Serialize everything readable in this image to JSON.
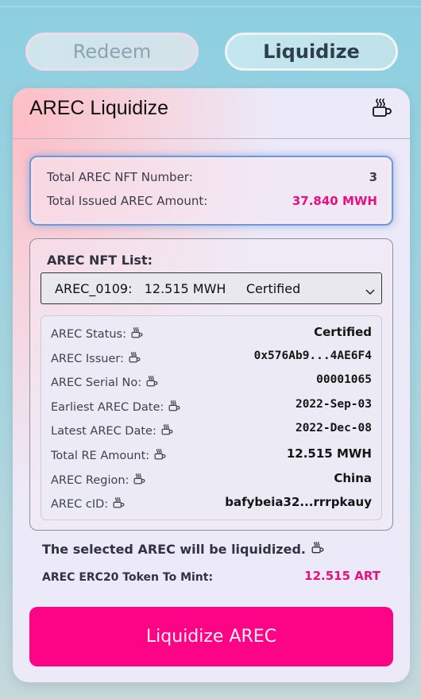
{
  "tabs": {
    "redeem_label": "Redeem",
    "liquidize_label": "Liquidize"
  },
  "card": {
    "title": "AREC Liquidize",
    "header_icon": "mug-icon"
  },
  "summary": {
    "nft_number_label": "Total AREC NFT Number:",
    "nft_number_value": "3",
    "issued_amount_label": "Total Issued AREC Amount:",
    "issued_amount_value": "37.840 MWH"
  },
  "nft_list": {
    "label": "AREC NFT List:",
    "selected_option": "AREC_0109:   12.515 MWH     Certified",
    "details": [
      {
        "label": "AREC Status:",
        "value": "Certified",
        "mono": false
      },
      {
        "label": "AREC Issuer:",
        "value": "0x576Ab9...4AE6F4",
        "mono": true
      },
      {
        "label": "AREC Serial No:",
        "value": "00001065",
        "mono": true
      },
      {
        "label": "Earliest AREC Date:",
        "value": "2022-Sep-03",
        "mono": true
      },
      {
        "label": "Latest AREC Date:",
        "value": "2022-Dec-08",
        "mono": true
      },
      {
        "label": "Total RE Amount:",
        "value": "12.515 MWH",
        "mono": false
      },
      {
        "label": "AREC Region:",
        "value": "China",
        "mono": false
      },
      {
        "label": "AREC cID:",
        "value": "bafybeia32...rrrpkauy",
        "mono": false
      }
    ]
  },
  "notice": "The selected AREC will be liquidized.",
  "mint": {
    "label": "AREC ERC20 Token To Mint:",
    "value": "12.515 ART"
  },
  "cta_label": "Liquidize AREC",
  "colors": {
    "accent_pink": "#fd0487",
    "value_pink": "#e8107e",
    "summary_border": "#6e98d6"
  }
}
